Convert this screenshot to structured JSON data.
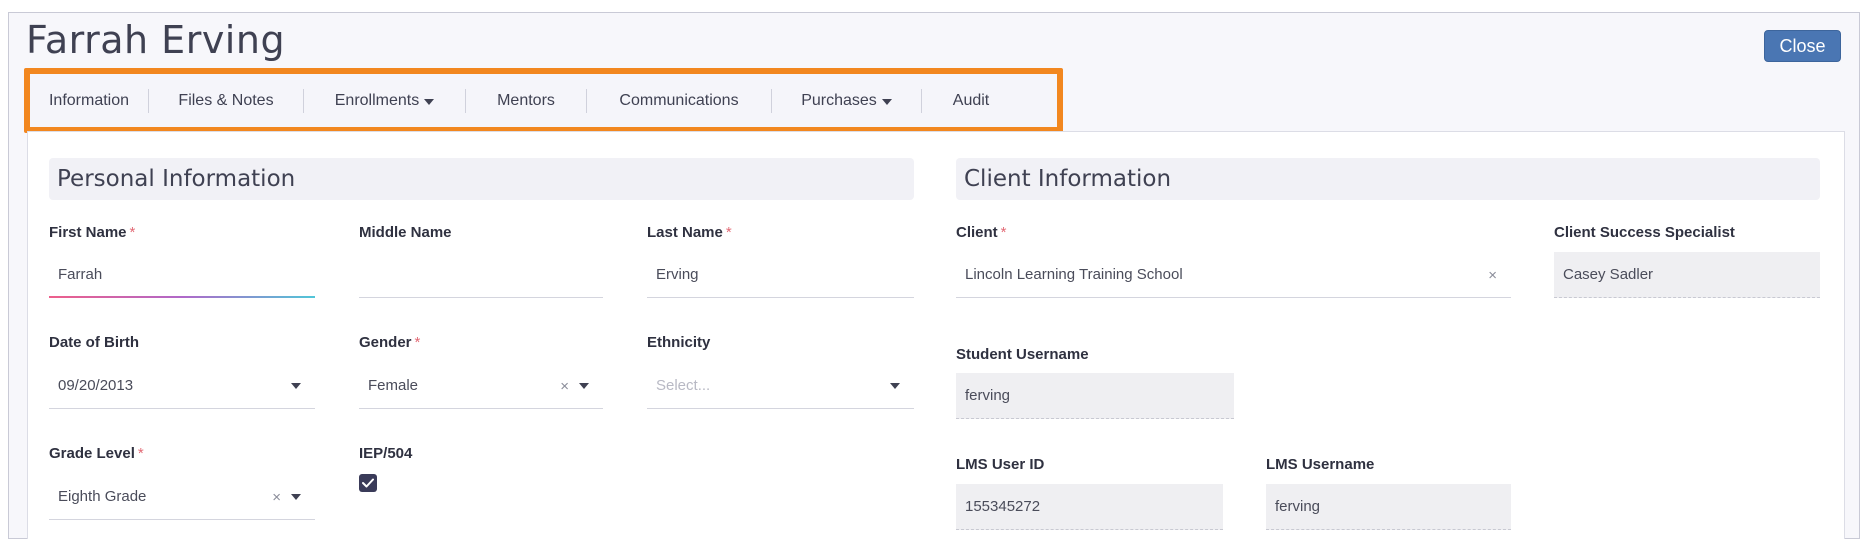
{
  "page": {
    "title": "Farrah Erving",
    "close_label": "Close"
  },
  "tabs": [
    {
      "label": "Information",
      "dropdown": false
    },
    {
      "label": "Files & Notes",
      "dropdown": false
    },
    {
      "label": "Enrollments",
      "dropdown": true
    },
    {
      "label": "Mentors",
      "dropdown": false
    },
    {
      "label": "Communications",
      "dropdown": false
    },
    {
      "label": "Purchases",
      "dropdown": true
    },
    {
      "label": "Audit",
      "dropdown": false
    }
  ],
  "personal": {
    "header": "Personal Information",
    "first_name": {
      "label": "First Name",
      "required": "*",
      "value": "Farrah"
    },
    "middle_name": {
      "label": "Middle Name",
      "value": ""
    },
    "last_name": {
      "label": "Last Name",
      "required": "*",
      "value": "Erving"
    },
    "dob": {
      "label": "Date of Birth",
      "value": "09/20/2013"
    },
    "gender": {
      "label": "Gender",
      "required": "*",
      "value": "Female"
    },
    "ethnicity": {
      "label": "Ethnicity",
      "placeholder": "Select..."
    },
    "grade_level": {
      "label": "Grade Level",
      "required": "*",
      "value": "Eighth Grade"
    },
    "iep": {
      "label": "IEP/504",
      "checked": true
    }
  },
  "client": {
    "header": "Client Information",
    "client": {
      "label": "Client",
      "required": "*",
      "value": "Lincoln Learning Training School"
    },
    "css": {
      "label": "Client Success Specialist",
      "value": "Casey Sadler"
    },
    "student_username": {
      "label": "Student Username",
      "value": "ferving"
    },
    "lms_user_id": {
      "label": "LMS User ID",
      "value": "155345272"
    },
    "lms_username": {
      "label": "LMS Username",
      "value": "ferving"
    }
  },
  "icons": {
    "clear": "×",
    "caret": "chevron-down-icon",
    "check": "check-icon"
  },
  "colors": {
    "highlight": "#f2871f",
    "close_button": "#4a76b3",
    "required": "#e26a75",
    "checkbox": "#3a3b59"
  }
}
